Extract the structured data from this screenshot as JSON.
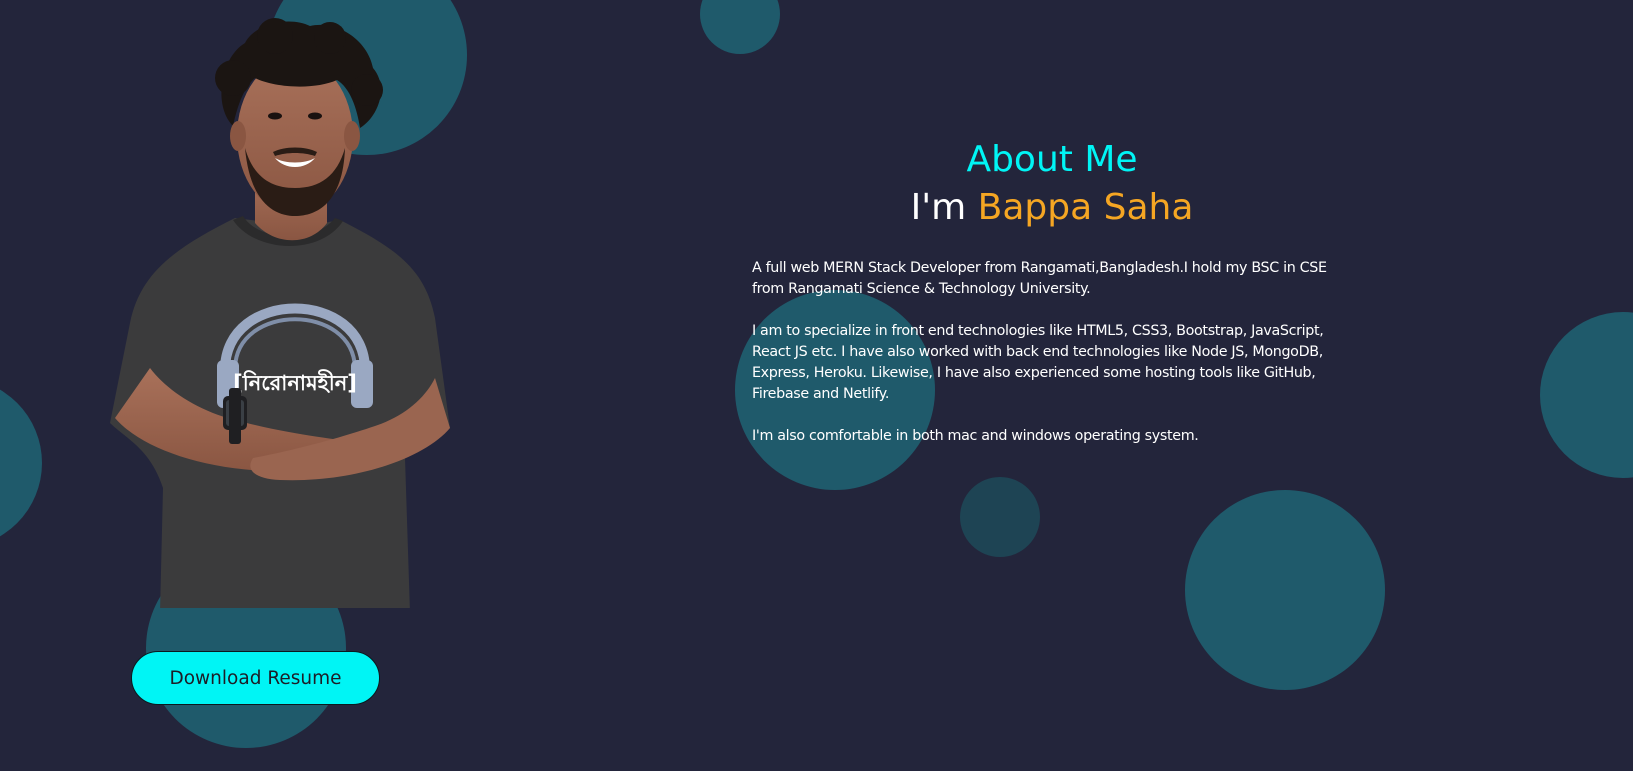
{
  "colors": {
    "background": "#23253b",
    "bubble": "#1f5a6b",
    "accent_cyan": "#00f5f5",
    "accent_orange": "#f5a623",
    "text": "#ffffff"
  },
  "about": {
    "heading": "About Me",
    "intro_prefix": "I'm ",
    "name": "Bappa Saha",
    "paragraphs": [
      "A full web MERN Stack Developer from Rangamati,Bangladesh.I hold my BSC in CSE from Rangamati Science & Technology University.",
      "I am to specialize in front end technologies like HTML5, CSS3, Bootstrap, JavaScript, React JS etc. I have also worked with back end technologies like Node JS, MongoDB, Express, Heroku. Likewise, I have also experienced some hosting tools like GitHub, Firebase and Netlify.",
      "I'm also comfortable in both mac and windows operating system."
    ]
  },
  "portrait": {
    "shirt_print": "[নিরোনামহীন]"
  },
  "resume_button": {
    "label": "Download Resume"
  }
}
